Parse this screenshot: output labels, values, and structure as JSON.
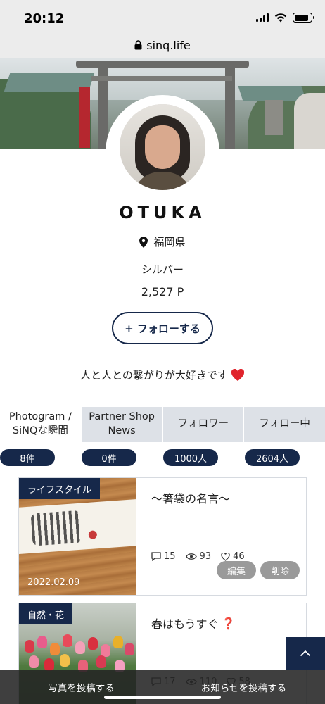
{
  "status_bar": {
    "time": "20:12"
  },
  "browser": {
    "url": "sinq.life"
  },
  "profile": {
    "name": "OTUKA",
    "location": "福岡県",
    "rank": "シルバー",
    "points": "2,527 P",
    "follow_label": "+ フォローする",
    "bio": "人と人との繋がりが大好きです",
    "bio_emoji": "❤️"
  },
  "tabs": [
    {
      "label": "Photogram /\nSiNQな瞬間",
      "count": "8件"
    },
    {
      "label": "Partner Shop\nNews",
      "count": "0件"
    },
    {
      "label": "フォロワー",
      "count": "1000人"
    },
    {
      "label": "フォロー中",
      "count": "2604人"
    }
  ],
  "posts": [
    {
      "category": "ライフスタイル",
      "title": "〜箸袋の名言〜",
      "comments": "15",
      "views": "93",
      "likes": "46",
      "date": "2022.02.09",
      "edit_label": "編集",
      "delete_label": "削除"
    },
    {
      "category": "自然・花",
      "title": "春はもうすぐ",
      "title_emoji": "❓",
      "comments": "17",
      "views": "110",
      "likes": "58"
    }
  ],
  "bottom_bar": {
    "post_photo": "写真を投稿する",
    "post_news": "お知らせを投稿する"
  },
  "colors": {
    "navy": "#16284a",
    "tab_bg": "#dde1e7",
    "button_gray": "#9a9a9a"
  }
}
